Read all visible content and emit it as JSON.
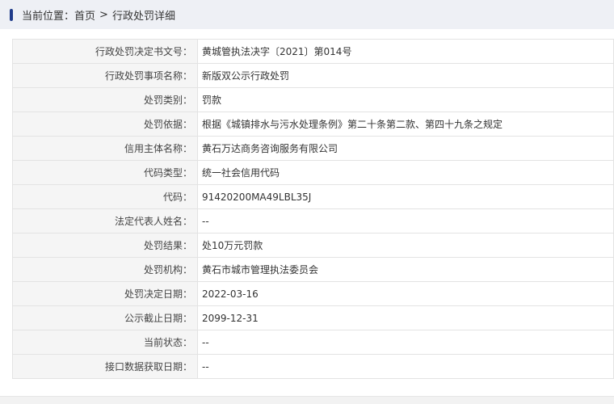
{
  "breadcrumb": {
    "prefix": "当前位置：",
    "home": "首页",
    "separator": ">",
    "current": "行政处罚详细"
  },
  "rows": [
    {
      "label": "行政处罚决定书文号：",
      "value": "黄城管执法决字〔2021〕第014号"
    },
    {
      "label": "行政处罚事项名称：",
      "value": "新版双公示行政处罚"
    },
    {
      "label": "处罚类别：",
      "value": "罚款"
    },
    {
      "label": "处罚依据：",
      "value": "根据《城镇排水与污水处理条例》第二十条第二款、第四十九条之规定"
    },
    {
      "label": "信用主体名称：",
      "value": "黄石万达商务咨询服务有限公司"
    },
    {
      "label": "代码类型：",
      "value": "统一社会信用代码"
    },
    {
      "label": "代码：",
      "value": "91420200MA49LBL35J"
    },
    {
      "label": "法定代表人姓名：",
      "value": "--"
    },
    {
      "label": "处罚结果：",
      "value": "处10万元罚款"
    },
    {
      "label": "处罚机构：",
      "value": "黄石市城市管理执法委员会"
    },
    {
      "label": "处罚决定日期：",
      "value": "2022-03-16"
    },
    {
      "label": "公示截止日期：",
      "value": "2099-12-31"
    },
    {
      "label": "当前状态：",
      "value": "--"
    },
    {
      "label": "接口数据获取日期：",
      "value": "--"
    }
  ]
}
